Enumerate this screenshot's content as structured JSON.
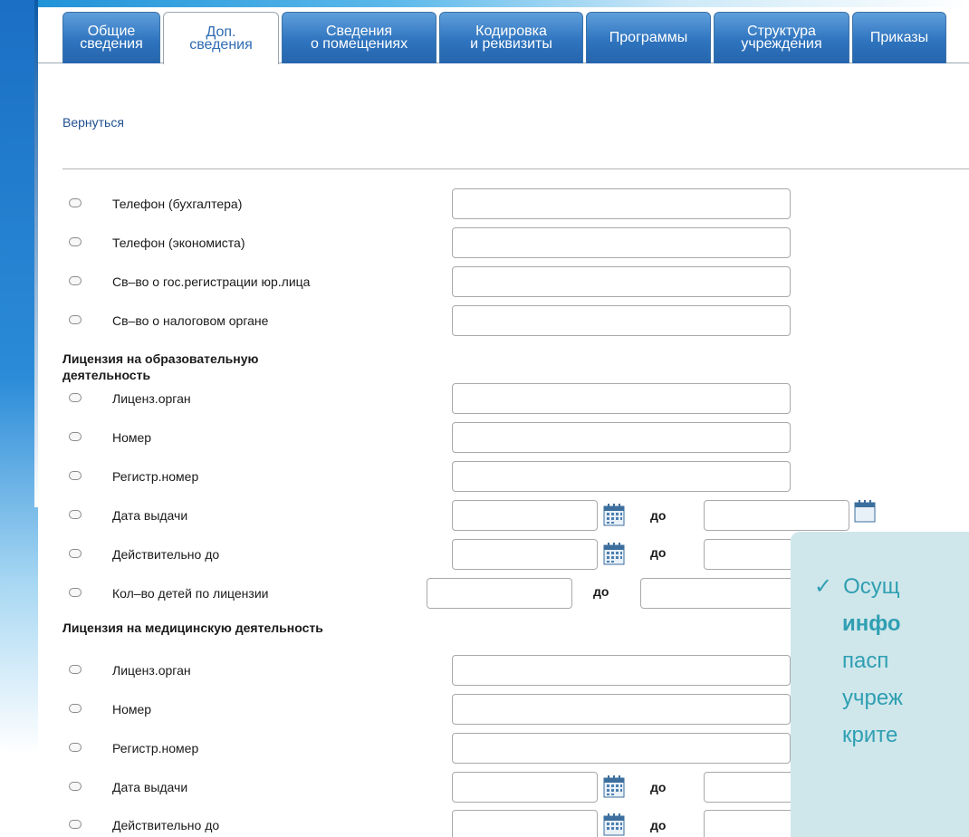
{
  "tabs": [
    {
      "label": "Общие\nсведения",
      "active": false
    },
    {
      "label": "Доп.\nсведения",
      "active": true
    },
    {
      "label": "Сведения\nо помещениях",
      "active": false
    },
    {
      "label": "Кодировка\nи реквизиты",
      "active": false
    },
    {
      "label": "Программы",
      "active": false
    },
    {
      "label": "Структура\nучреждения",
      "active": false
    },
    {
      "label": "Приказы",
      "active": false
    }
  ],
  "back_link": "Вернуться",
  "rows": {
    "phone_accountant": "Телефон (бухгалтера)",
    "phone_economist": "Телефон (экономиста)",
    "state_registration": "Св–во о гос.регистрации юр.лица",
    "tax_authority": "Св–во о налоговом органе"
  },
  "education_license": {
    "title": "Лицензия на образовательную\nдеятельность",
    "licensing_body": "Лиценз.орган",
    "number": "Номер",
    "reg_number": "Регистр.номер",
    "issue_date": "Дата выдачи",
    "valid_until": "Действительно до",
    "children_count": "Кол–во детей по лицензии"
  },
  "medical_license": {
    "title": "Лицензия на медицинскую деятельность",
    "licensing_body": "Лиценз.орган",
    "number": "Номер",
    "reg_number": "Регистр.номер",
    "issue_date": "Дата выдачи",
    "valid_until": "Действительно до"
  },
  "range_separator": "до",
  "note": {
    "check": "✓",
    "line1": "Осущ",
    "line2": "инфо",
    "line3": "пасп",
    "line4": "учреж",
    "line5": "крите"
  },
  "icons": {
    "calendar": "calendar-icon",
    "radio": "radio-button"
  },
  "colors": {
    "tab_blue": "#2f74bf",
    "link_blue": "#1f4f8f",
    "note_bg": "#cfe7eb",
    "note_text": "#2f9fb2"
  }
}
